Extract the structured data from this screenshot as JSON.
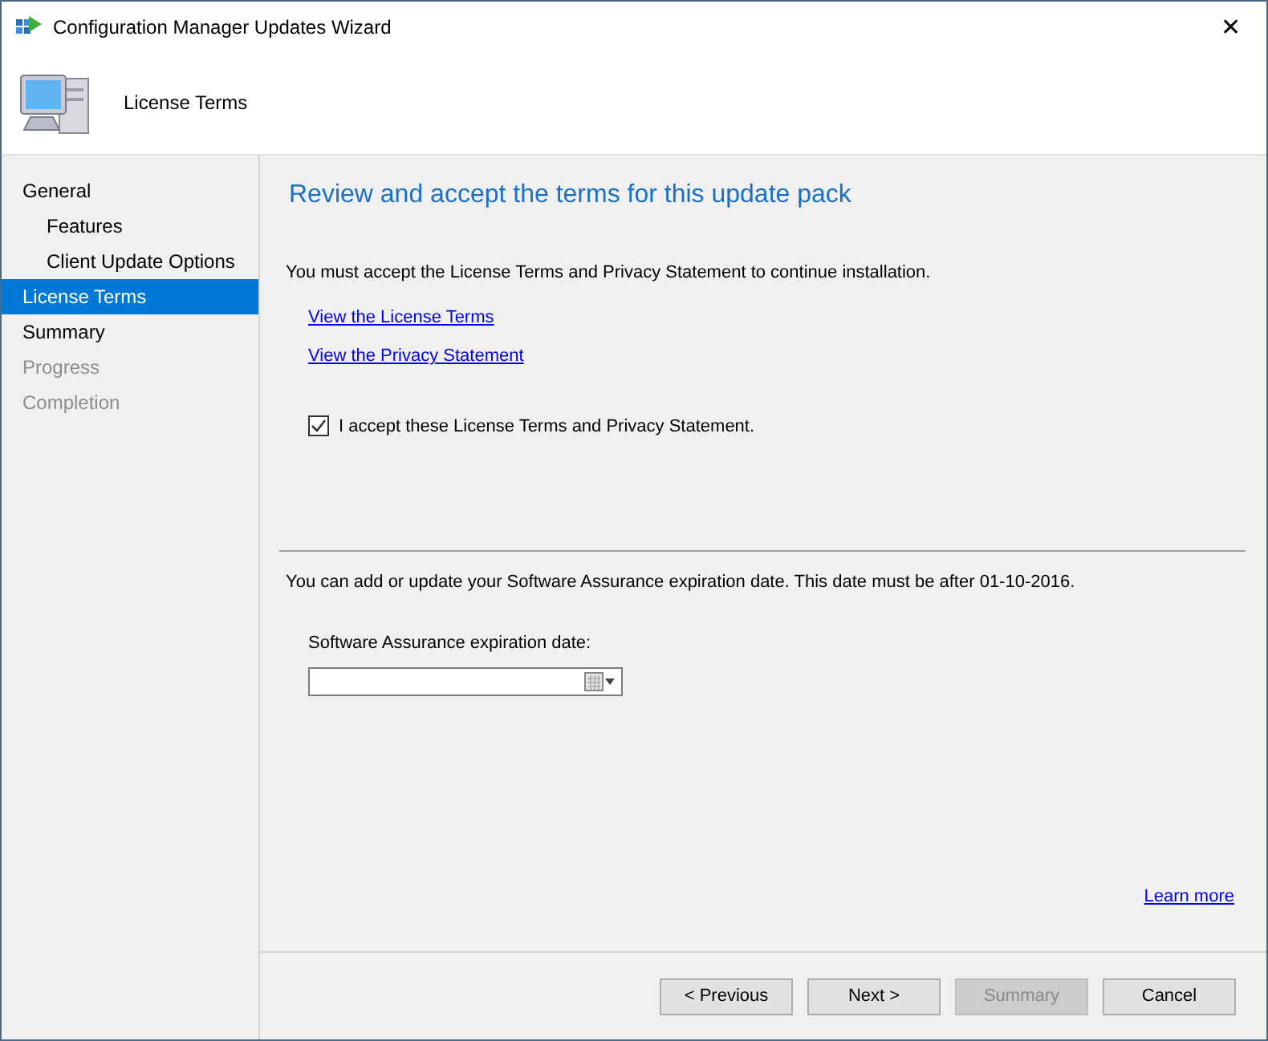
{
  "window": {
    "title": "Configuration Manager Updates Wizard",
    "close": "✕"
  },
  "header": {
    "title": "License Terms"
  },
  "sidebar": {
    "items": [
      {
        "label": "General",
        "selected": false,
        "disabled": false,
        "children": [
          {
            "label": "Features",
            "selected": false,
            "disabled": false
          },
          {
            "label": "Client Update Options",
            "selected": false,
            "disabled": false
          }
        ]
      },
      {
        "label": "License Terms",
        "selected": true,
        "disabled": false
      },
      {
        "label": "Summary",
        "selected": false,
        "disabled": false
      },
      {
        "label": "Progress",
        "selected": false,
        "disabled": true
      },
      {
        "label": "Completion",
        "selected": false,
        "disabled": true
      }
    ]
  },
  "content": {
    "heading": "Review and accept the terms for this update pack",
    "intro": "You must accept the License Terms and Privacy Statement to continue installation.",
    "links": [
      "View the License Terms",
      "View the Privacy Statement"
    ],
    "accept": {
      "label": "I accept these License Terms and Privacy Statement.",
      "checked": true
    },
    "assurance_note": "You can add or update your Software Assurance expiration date. This date must be after 01-10-2016.",
    "date_label": "Software Assurance expiration date:",
    "learn_more": "Learn more"
  },
  "buttons": [
    {
      "label": "< Previous",
      "disabled": false
    },
    {
      "label": "Next >",
      "disabled": false
    },
    {
      "label": "Summary",
      "disabled": true
    },
    {
      "label": "Cancel",
      "disabled": false
    }
  ]
}
